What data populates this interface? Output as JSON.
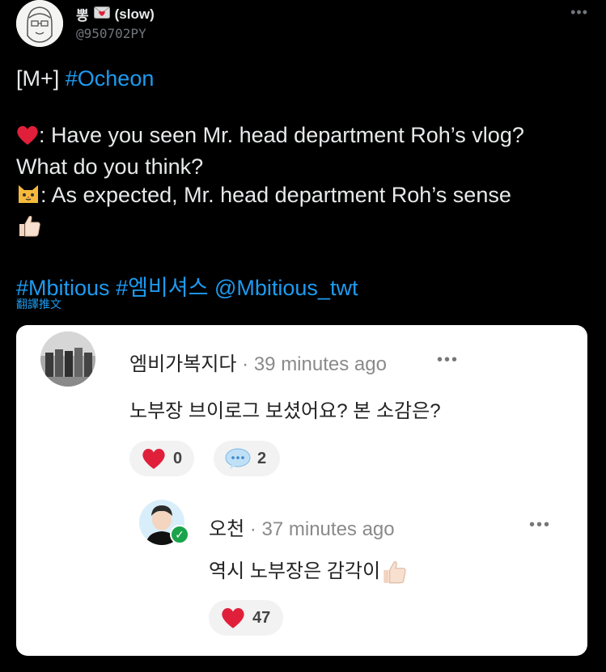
{
  "author": {
    "display_name": "뽕",
    "status": "(slow)",
    "handle": "@950702PY"
  },
  "tweet": {
    "line1_prefix": "[M+] ",
    "line1_hashtag": "#Ocheon",
    "line2": ": Have you seen Mr. head department Roh’s vlog?",
    "line3": "What do you think?",
    "line4": ": As expected, Mr. head department Roh’s sense",
    "tags": [
      "#Mbitious",
      "#엠비셔스",
      "@Mbitious_twt"
    ],
    "translate": "翻譯推文"
  },
  "card": {
    "comment": {
      "username": "엠비가복지다",
      "separator": "·",
      "time": "39 minutes ago",
      "dots": "•••",
      "text": "노부장 브이로그 보셨어요? 본 소감은?",
      "likes": "0",
      "replies": "2"
    },
    "reply": {
      "username": "오천",
      "separator": "·",
      "time": "37 minutes ago",
      "dots": "•••",
      "text": "역시 노부장은 감각이",
      "likes": "47"
    }
  },
  "colors": {
    "link": "#1d9bf0",
    "heart": "#e0203a",
    "verified": "#1aa34a"
  },
  "icons": [
    "more-icon",
    "heart-emoji",
    "cat-emoji",
    "thumbs-up-emoji",
    "letter-heart-emoji",
    "speech-bubble-icon",
    "verified-icon"
  ]
}
